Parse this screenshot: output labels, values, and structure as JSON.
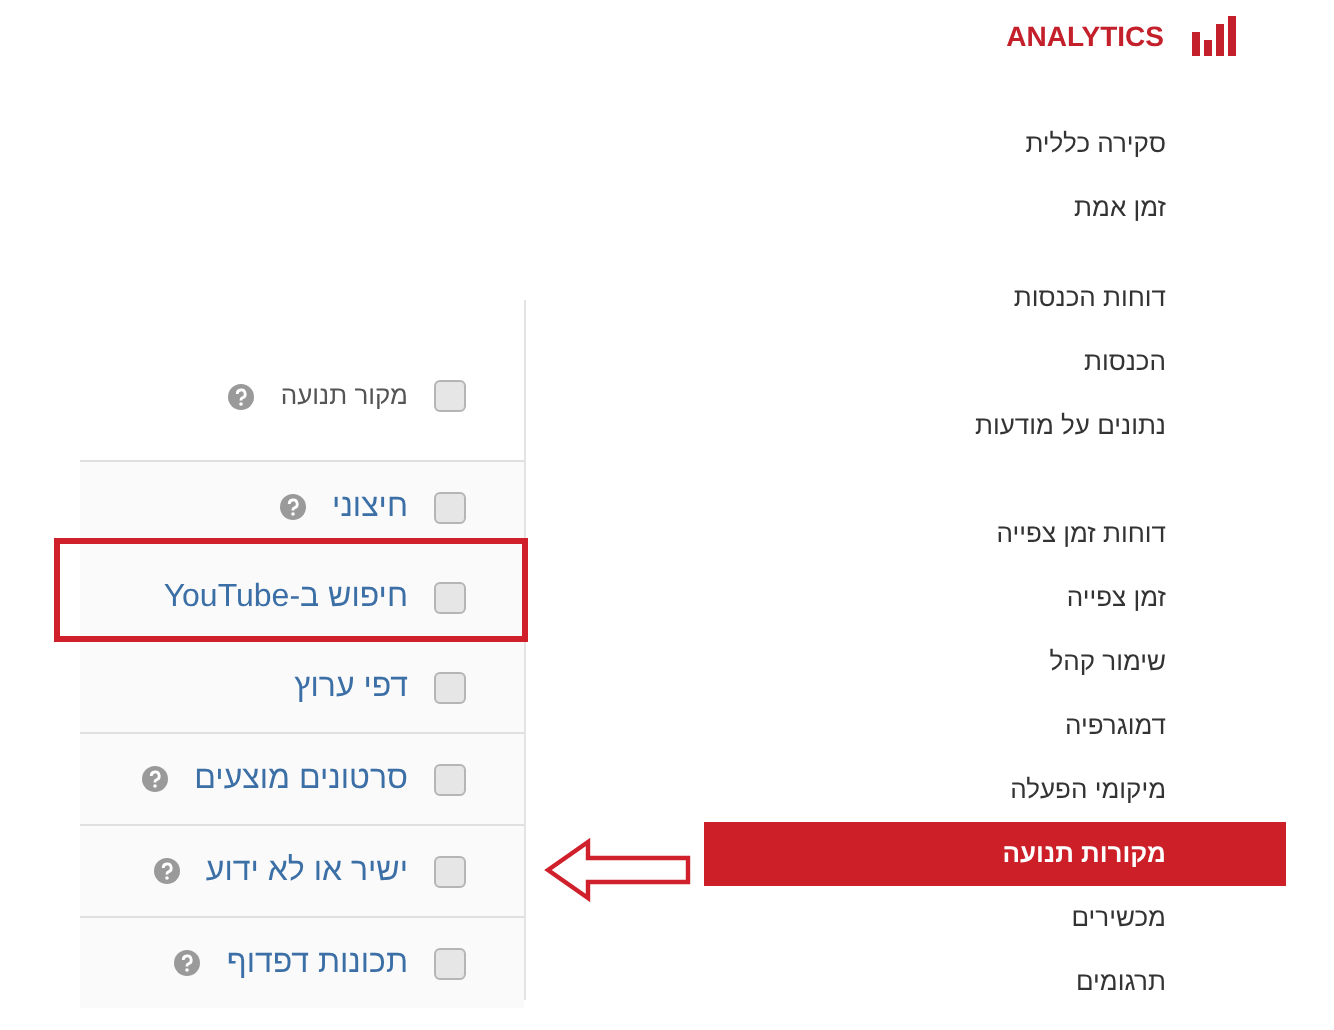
{
  "sidebar": {
    "title": "ANALYTICS",
    "groups": [
      [
        {
          "label": "סקירה כללית",
          "selected": false
        },
        {
          "label": "זמן אמת",
          "selected": false
        }
      ],
      [
        {
          "label": "דוחות הכנסות",
          "selected": false
        },
        {
          "label": "הכנסות",
          "selected": false
        },
        {
          "label": "נתונים על מודעות",
          "selected": false
        }
      ],
      [
        {
          "label": "דוחות זמן צפייה",
          "selected": false
        },
        {
          "label": "זמן צפייה",
          "selected": false
        },
        {
          "label": "שימור קהל",
          "selected": false
        },
        {
          "label": "דמוגרפיה",
          "selected": false
        },
        {
          "label": "מיקומי הפעלה",
          "selected": false
        },
        {
          "label": "מקורות תנועה",
          "selected": true
        },
        {
          "label": "מכשירים",
          "selected": false
        },
        {
          "label": "תרגומים",
          "selected": false
        }
      ]
    ]
  },
  "filter_panel": {
    "header": {
      "label": "מקור תנועה",
      "checked": false,
      "help": true
    },
    "groups": [
      [
        {
          "label": "חיצוני",
          "checked": false,
          "help": true,
          "highlighted": false,
          "arrow": false
        },
        {
          "label": "חיפוש ב-YouTube",
          "checked": false,
          "help": false,
          "highlighted": true,
          "arrow": false
        },
        {
          "label": "דפי ערוץ",
          "checked": false,
          "help": false,
          "highlighted": false,
          "arrow": false
        }
      ],
      [
        {
          "label": "סרטונים מוצעים",
          "checked": false,
          "help": true,
          "highlighted": false,
          "arrow": false
        }
      ],
      [
        {
          "label": "ישיר או לא ידוע",
          "checked": false,
          "help": true,
          "highlighted": false,
          "arrow": true
        }
      ],
      [
        {
          "label": "תכונות דפדוף",
          "checked": false,
          "help": true,
          "highlighted": false,
          "arrow": false
        }
      ]
    ]
  }
}
